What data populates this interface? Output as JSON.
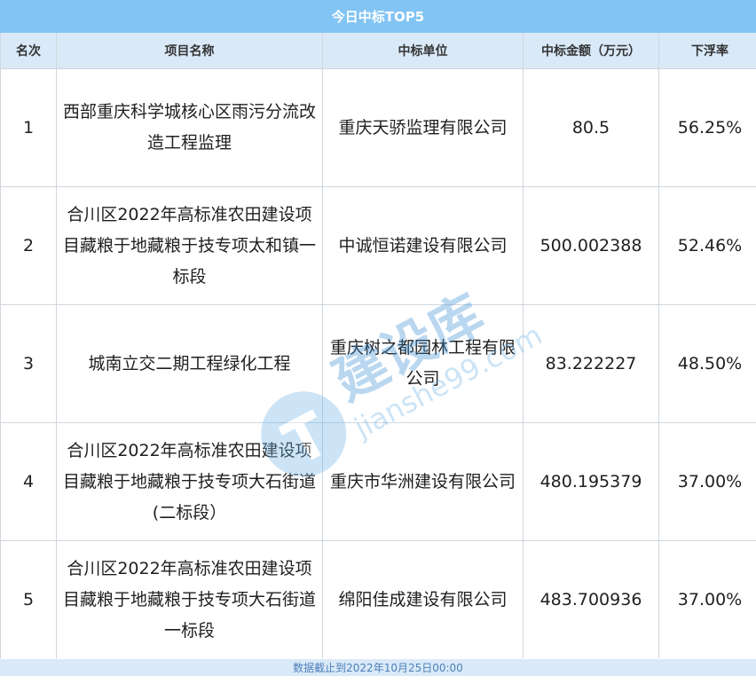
{
  "table": {
    "title": "今日中标TOP5",
    "headers": [
      "名次",
      "项目名称",
      "中标单位",
      "中标金额（万元）",
      "下浮率"
    ],
    "rows": [
      {
        "rank": "1",
        "project": "西部重庆科学城核心区雨污分流改造工程监理",
        "company": "重庆天骄监理有限公司",
        "amount": "80.5",
        "rate": "56.25%"
      },
      {
        "rank": "2",
        "project": "合川区2022年高标准农田建设项目藏粮于地藏粮于技专项太和镇一标段",
        "company": "中诚恒诺建设有限公司",
        "amount": "500.002388",
        "rate": "52.46%"
      },
      {
        "rank": "3",
        "project": "城南立交二期工程绿化工程",
        "company": "重庆树之都园林工程有限公司",
        "amount": "83.222227",
        "rate": "48.50%"
      },
      {
        "rank": "4",
        "project": "合川区2022年高标准农田建设项目藏粮于地藏粮于技专项大石街道(二标段）",
        "company": "重庆市华洲建设有限公司",
        "amount": "480.195379",
        "rate": "37.00%"
      },
      {
        "rank": "5",
        "project": "合川区2022年高标准农田建设项目藏粮于地藏粮于技专项大石街道一标段",
        "company": "绵阳佳成建设有限公司",
        "amount": "483.700936",
        "rate": "37.00%"
      }
    ],
    "footer": "数据截止到2022年10月25日00:00"
  },
  "watermark": {
    "brand": "建设库",
    "domain": "jianshe99.com"
  },
  "colors": {
    "header_bar": "#82c4f3",
    "header_row": "#d9e9f8",
    "grid_line": "#cfd6dd",
    "footer_text": "#4d7fb8"
  }
}
